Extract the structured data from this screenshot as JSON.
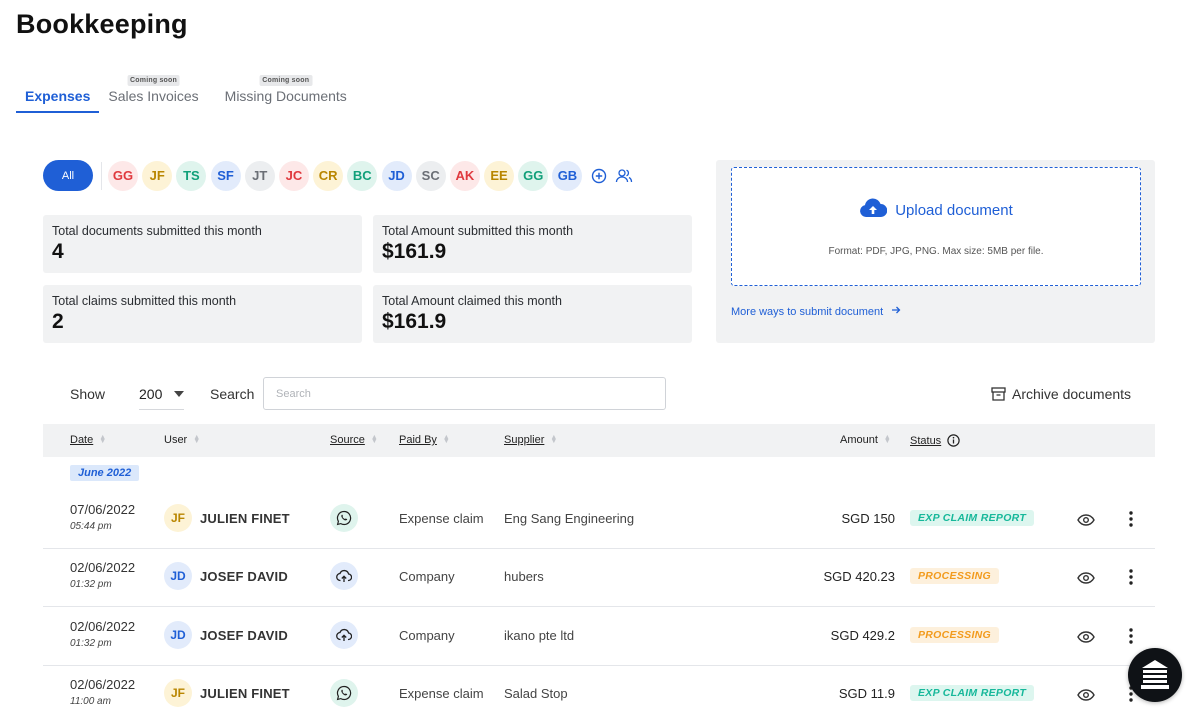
{
  "page_title": "Bookkeeping",
  "tabs": [
    {
      "label": "Expenses",
      "badge": ""
    },
    {
      "label": "Sales Invoices",
      "badge": "Coming soon"
    },
    {
      "label": "Missing Documents",
      "badge": "Coming soon"
    }
  ],
  "filters": {
    "all_label": "All",
    "users": [
      {
        "initials": "GG",
        "fg": "#e0393e",
        "bg": "#fde8e8"
      },
      {
        "initials": "JF",
        "fg": "#b98600",
        "bg": "#fdf3d6"
      },
      {
        "initials": "TS",
        "fg": "#12a07a",
        "bg": "#dff4ed"
      },
      {
        "initials": "SF",
        "fg": "#1f5fd6",
        "bg": "#e2ebfb"
      },
      {
        "initials": "JT",
        "fg": "#6b6f76",
        "bg": "#eceef0"
      },
      {
        "initials": "JC",
        "fg": "#e0393e",
        "bg": "#fde8e8"
      },
      {
        "initials": "CR",
        "fg": "#b98600",
        "bg": "#fdf3d6"
      },
      {
        "initials": "BC",
        "fg": "#12a07a",
        "bg": "#dff4ed"
      },
      {
        "initials": "JD",
        "fg": "#1f5fd6",
        "bg": "#e2ebfb"
      },
      {
        "initials": "SC",
        "fg": "#6b6f76",
        "bg": "#eceef0"
      },
      {
        "initials": "AK",
        "fg": "#e0393e",
        "bg": "#fde8e8"
      },
      {
        "initials": "EE",
        "fg": "#b98600",
        "bg": "#fdf3d6"
      },
      {
        "initials": "GG",
        "fg": "#12a07a",
        "bg": "#dff4ed"
      },
      {
        "initials": "GB",
        "fg": "#1f5fd6",
        "bg": "#e2ebfb"
      }
    ]
  },
  "stats": {
    "docs_label": "Total documents submitted this month",
    "docs_value": "4",
    "amount_submitted_label": "Total Amount submitted this month",
    "amount_submitted_value": "$161.9",
    "claims_label": "Total claims submitted this month",
    "claims_value": "2",
    "amount_claimed_label": "Total Amount claimed this month",
    "amount_claimed_value": "$161.9"
  },
  "upload": {
    "label": "Upload document",
    "format": "Format: PDF, JPG, PNG. Max size: 5MB per file.",
    "more_ways": "More ways to submit document"
  },
  "toolbar": {
    "show_label": "Show",
    "page_size": "200",
    "search_label": "Search",
    "search_placeholder": "Search",
    "archive_label": "Archive documents"
  },
  "table": {
    "headers": {
      "date": "Date",
      "user": "User",
      "source": "Source",
      "paid_by": "Paid By",
      "supplier": "Supplier",
      "amount": "Amount",
      "status": "Status"
    },
    "month": "June 2022",
    "rows": [
      {
        "date": "07/06/2022",
        "time": "05:44 pm",
        "initials": "JF",
        "user": "JULIEN FINET",
        "source": "whatsapp-icon",
        "paid_by": "Expense claim",
        "supplier": "Eng Sang Engineering",
        "amount": "SGD 150",
        "status": "EXP CLAIM REPORT"
      },
      {
        "date": "02/06/2022",
        "time": "01:32 pm",
        "initials": "JD",
        "user": "JOSEF DAVID",
        "source": "cloud-upload-icon",
        "paid_by": "Company",
        "supplier": "hubers",
        "amount": "SGD 420.23",
        "status": "PROCESSING"
      },
      {
        "date": "02/06/2022",
        "time": "01:32 pm",
        "initials": "JD",
        "user": "JOSEF DAVID",
        "source": "cloud-upload-icon",
        "paid_by": "Company",
        "supplier": "ikano pte ltd",
        "amount": "SGD 429.2",
        "status": "PROCESSING"
      },
      {
        "date": "02/06/2022",
        "time": "11:00 am",
        "initials": "JF",
        "user": "JULIEN FINET",
        "source": "whatsapp-icon",
        "paid_by": "Expense claim",
        "supplier": "Salad Stop",
        "amount": "SGD 11.9",
        "status": "EXP CLAIM REPORT"
      }
    ]
  },
  "colors": {
    "accent": "#1f5fd6",
    "claim_fg": "#16b89a",
    "claim_bg": "#ddf6ef",
    "processing_fg": "#f29b1d",
    "processing_bg": "#fdf0dc"
  }
}
